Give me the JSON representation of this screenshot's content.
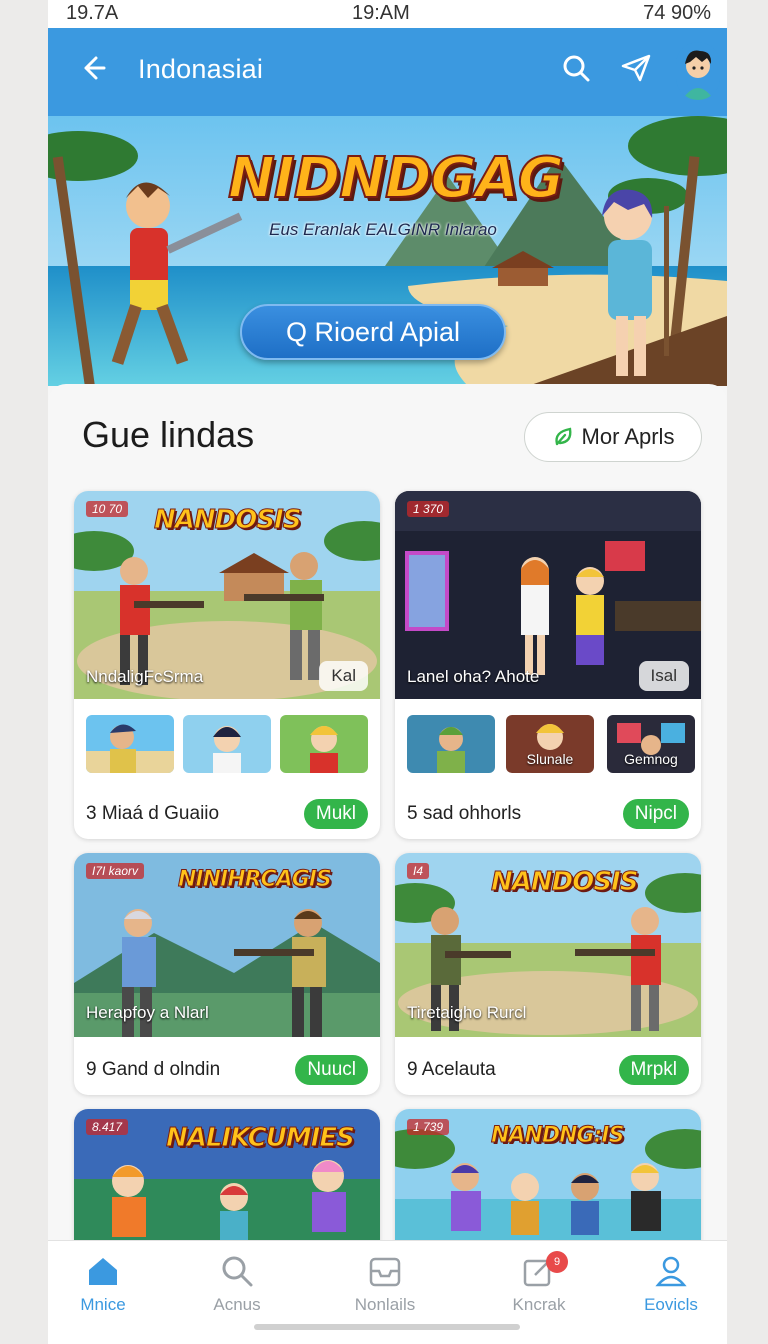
{
  "status": {
    "left": "19.7A",
    "time": "19:AM",
    "right": "74 90%"
  },
  "appbar": {
    "title": "Indonasiai",
    "back_icon": "arrow-left-icon",
    "search_icon": "search-icon",
    "send_icon": "send-icon"
  },
  "hero": {
    "title": "NIDNDGAG",
    "subtitle": "Eus Eranlak EALGINR Inlarao",
    "button": "Q Rioerd Apial"
  },
  "section": {
    "title": "Gue lindas",
    "more_label": "Mor Aprls"
  },
  "cards": [
    {
      "tag": "10 70",
      "game": "NANDOSIS",
      "caption": "NndaligFcSrma",
      "pill": "Kal",
      "footer": "3 Miaá d Guaiio",
      "status": "Mukl",
      "thumb_labels": [
        "",
        "",
        ""
      ]
    },
    {
      "tag": "1 370",
      "game": "",
      "caption": "Lanel oha? Ahote",
      "pill": "Isal",
      "footer": "5 sad ohhorls",
      "status": "Nipcl",
      "thumb_labels": [
        "",
        "Slunale",
        "Gemnog"
      ]
    },
    {
      "tag": "I7I kaorv",
      "game": "NINIHRCAGIS",
      "caption": "Herapfoy a Nlarl",
      "pill": "",
      "footer": "9 Gand d olndin",
      "status": "Nuucl"
    },
    {
      "tag": "I4",
      "game": "NANDOSIS",
      "caption": "Tiretaigho Rurcl",
      "pill": "",
      "footer": "9 Acelauta",
      "status": "Mrpkl"
    },
    {
      "tag": "8.417",
      "game": "NALIKCUMIES",
      "caption": "",
      "pill": "",
      "footer": "",
      "status": ""
    },
    {
      "tag": "1 739",
      "game": "NANDNG:IS",
      "caption": "",
      "pill": "",
      "footer": "",
      "status": ""
    }
  ],
  "nav": [
    {
      "label": "Mnice",
      "icon": "home-icon"
    },
    {
      "label": "Acnus",
      "icon": "search-icon"
    },
    {
      "label": "Nonlails",
      "icon": "inbox-icon"
    },
    {
      "label": "Kncrak",
      "icon": "edit-icon",
      "badge": "9"
    },
    {
      "label": "Eovicls",
      "icon": "profile-icon"
    }
  ],
  "colors": {
    "accent": "#3b99e0",
    "status_green": "#33b54a"
  }
}
